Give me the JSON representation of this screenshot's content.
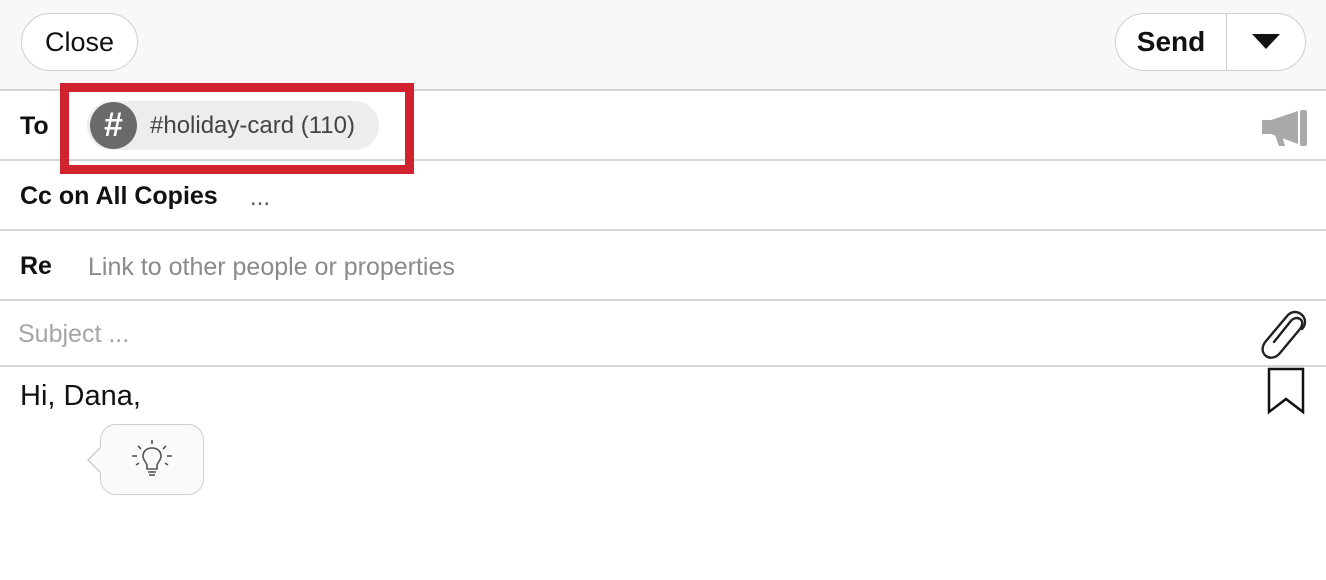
{
  "toolbar": {
    "close_label": "Close",
    "send_label": "Send",
    "send_menu_icon": "caret-down-icon"
  },
  "to": {
    "label": "To",
    "recipient_chip": {
      "icon_glyph": "#",
      "text": "#holiday-card (110)"
    },
    "broadcast_icon": "megaphone-icon",
    "highlight_color": "#d0232d"
  },
  "cc": {
    "label": "Cc on All Copies",
    "value": "..."
  },
  "re": {
    "label": "Re",
    "placeholder": "Link to other people or properties"
  },
  "subject": {
    "placeholder": "Subject ...",
    "attach_icon": "paperclip-icon"
  },
  "body": {
    "greeting": "Hi, Dana,",
    "bookmark_icon": "bookmark-icon",
    "tip_icon": "lightbulb-icon"
  }
}
